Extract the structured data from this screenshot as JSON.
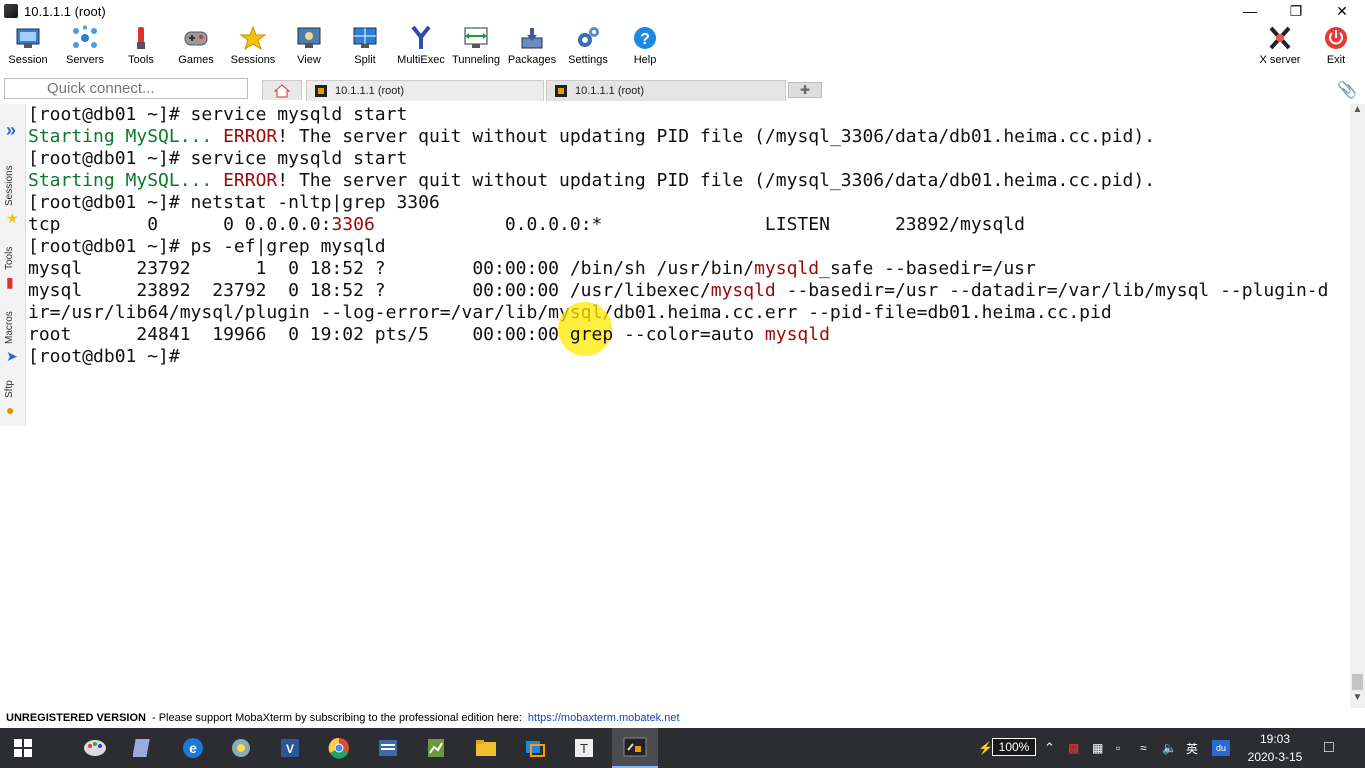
{
  "window": {
    "title": "10.1.1.1 (root)"
  },
  "toolbar": {
    "items": [
      {
        "label": "Session",
        "icon": "session-icon"
      },
      {
        "label": "Servers",
        "icon": "servers-icon"
      },
      {
        "label": "Tools",
        "icon": "tools-icon"
      },
      {
        "label": "Games",
        "icon": "games-icon"
      },
      {
        "label": "Sessions",
        "icon": "sessions-star-icon"
      },
      {
        "label": "View",
        "icon": "view-icon"
      },
      {
        "label": "Split",
        "icon": "split-icon"
      },
      {
        "label": "MultiExec",
        "icon": "multiexec-icon"
      },
      {
        "label": "Tunneling",
        "icon": "tunneling-icon"
      },
      {
        "label": "Packages",
        "icon": "packages-icon"
      },
      {
        "label": "Settings",
        "icon": "settings-icon"
      },
      {
        "label": "Help",
        "icon": "help-icon"
      },
      {
        "label": "X server",
        "icon": "xserver-icon"
      },
      {
        "label": "Exit",
        "icon": "power-icon"
      }
    ]
  },
  "tabs": {
    "quick_connect_placeholder": "Quick connect...",
    "items": [
      {
        "label": "10.1.1.1 (root)"
      },
      {
        "label": "10.1.1.1 (root)"
      }
    ]
  },
  "sidebar": {
    "sessions": "Sessions",
    "tools": "Tools",
    "macros": "Macros",
    "sftp": "Sftp"
  },
  "terminal": {
    "l1": "[root@db01 ~]# service mysqld start",
    "l2a": "Starting MySQL... ",
    "l2b": "ERROR",
    "l2c": "! The server quit without updating PID file (/mysql_3306/data/db01.heima.cc.pid).",
    "l3": "[root@db01 ~]# service mysqld start",
    "l4a": "Starting MySQL... ",
    "l4b": "ERROR",
    "l4c": "! The server quit without updating PID file (/mysql_3306/data/db01.heima.cc.pid).",
    "l5": "[root@db01 ~]# netstat -nltp|grep 3306",
    "l6a": "tcp        0      0 0.0.0.0:",
    "l6b": "3306",
    "l6c": "            0.0.0.0:*               LISTEN      23892/mysqld",
    "l7": "[root@db01 ~]# ps -ef|grep mysqld",
    "l8a": "mysql     23792      1  0 18:52 ?        00:00:00 /bin/sh /usr/bin/",
    "l8b": "mysqld",
    "l8c": "_safe --basedir=/usr",
    "l9a": "mysql     23892  23792  0 18:52 ?        00:00:00 /usr/libexec/",
    "l9b": "mysqld",
    "l9c": " --basedir=/usr --datadir=/var/lib/mysql --plugin-d",
    "l10": "ir=/usr/lib64/mysql/plugin --log-error=/var/lib/mysql/db01.heima.cc.err --pid-file=db01.heima.cc.pid",
    "l11a": "root      24841  19966  0 19:02 pts/5    00:00:00 grep --color=auto ",
    "l11b": "mysqld",
    "l12": "[root@db01 ~]#"
  },
  "status": {
    "unregistered": "UNREGISTERED VERSION",
    "message": " -  Please support MobaXterm by subscribing to the professional edition here:",
    "link": "https://mobaxterm.mobatek.net"
  },
  "taskbar": {
    "battery": "100%",
    "ime": "英",
    "time": "19:03",
    "date": "2020-3-15"
  },
  "colors": {
    "prompt": "#111111",
    "starting": "#0a7a2a",
    "error": "#9a0a0a",
    "highlight": "#ffeb00"
  }
}
